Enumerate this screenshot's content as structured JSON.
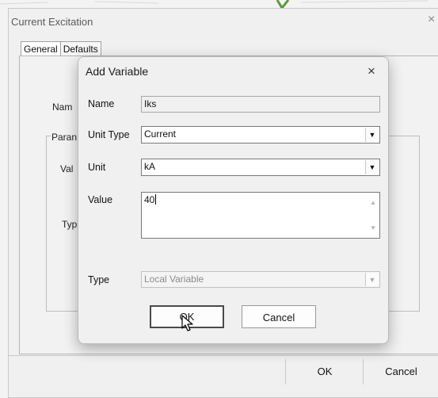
{
  "outer_dialog": {
    "title": "Current Excitation",
    "close_glyph": "×",
    "tabs": [
      {
        "label": "General",
        "active": true
      },
      {
        "label": "Defaults",
        "active": false
      }
    ],
    "partial_labels": {
      "name": "Nam",
      "parameters": "Paran",
      "value": "Val",
      "type": "Typ"
    },
    "buttons": {
      "ok": "OK",
      "cancel": "Cancel"
    }
  },
  "modal": {
    "title": "Add Variable",
    "close_glyph": "×",
    "fields": {
      "name": {
        "label": "Name",
        "value": "Iks"
      },
      "unit_type": {
        "label": "Unit Type",
        "value": "Current"
      },
      "unit": {
        "label": "Unit",
        "value": "kA"
      },
      "value": {
        "label": "Value",
        "value": "40"
      },
      "type": {
        "label": "Type",
        "value": "Local Variable"
      }
    },
    "buttons": {
      "ok": "OK",
      "cancel": "Cancel"
    }
  },
  "icons": {
    "dropdown": "chevron-down-icon",
    "close": "close-icon",
    "scroll_up": "scroll-up-arrow-icon",
    "scroll_down": "scroll-down-arrow-icon",
    "cursor": "mouse-pointer-icon"
  },
  "colors": {
    "dialog_bg": "#f0f0f0",
    "field_border": "#7a7a7a",
    "default_button_border": "#4a4a4a"
  }
}
